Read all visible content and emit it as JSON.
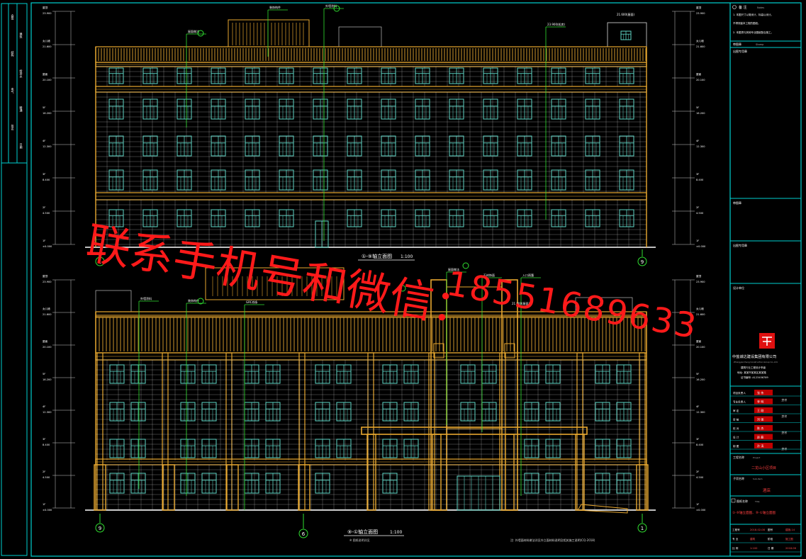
{
  "drawing": {
    "upper_title": "①-⑨轴立面图",
    "upper_scale": "1:100",
    "lower_title": "⑨-①轴立面图",
    "lower_scale": "1:100",
    "lower_subnote": "※ 图纸说明详见",
    "upper_axis_left": "1",
    "upper_axis_right": "9",
    "lower_axis_left": "9",
    "lower_axis_mid": "6",
    "lower_axis_right": "1",
    "bottom_note": "注: 外墙面材料做法详见外立面材料说明及相关施工说明(CQ-2018)"
  },
  "elevation_labels_left": [
    {
      "level": "1F",
      "value": "±0.000"
    },
    {
      "level": "2F",
      "value": "4.500"
    },
    {
      "level": "3F",
      "value": "8.400"
    },
    {
      "level": "4F",
      "value": "12.300"
    },
    {
      "level": "5F",
      "value": "16.200"
    },
    {
      "level": "屋面",
      "value": "20.100"
    },
    {
      "level": "女儿墙",
      "value": "21.600"
    },
    {
      "level": "屋顶",
      "value": "23.900"
    }
  ],
  "upper_callouts": [
    "屋面做法",
    "装饰构件",
    "外墙涂料",
    "21.600(屋面)",
    "23.900(机房)"
  ],
  "lower_callouts": [
    "外墙涂料",
    "装饰构件",
    "屋面做法",
    "GRC线条",
    "21.600(屋面)",
    "入口雨篷",
    "石材饰面"
  ],
  "title_block": {
    "notes_heading": "备 注",
    "notes_heading_en": "Notes",
    "notes": [
      "1. 本图尺寸以毫米计，标高以米计。",
      "不得测量本工程的图纸。",
      "2. 本图须与其他专业图纸配合施工。"
    ],
    "drawing_stamp": "审图章",
    "stamp_en": "Stamp",
    "chop_label": "出图专用章",
    "design_heading": "设计单位",
    "company_name": "中盐诚达建设集团有限公司",
    "company_en": "Zhongyancheng Construction Group Co.,Ltd.",
    "company_sub": "建筑行业工程设计甲级",
    "company_address": "地址: 某某市某某区某某路",
    "company_cert": "证书编号: A123456789",
    "roles": [
      {
        "role": "项目负责人",
        "name": "张 伟"
      },
      {
        "role": "专业负责人",
        "name": "李 明"
      },
      {
        "role": "审 定",
        "name": "王 刚"
      },
      {
        "role": "审 核",
        "name": "刘 强"
      },
      {
        "role": "校 对",
        "name": "陈 杰"
      },
      {
        "role": "设 计",
        "name": "赵 磊"
      },
      {
        "role": "制 图",
        "name": "孙 涛"
      }
    ],
    "signatures": [
      "签名",
      "签名",
      "签名",
      "签名"
    ],
    "project_label": "工程名称",
    "project_label_en": "Project",
    "project_name": "二龙山小区项目",
    "subproject_label": "子项名称",
    "subproject_label_en": "Sub-item",
    "subproject_name": "酒店",
    "drawing_name_label": "图纸名称",
    "drawing_name_label_en": "Title",
    "drawing_name": "①-⑨轴立面图、⑨-①轴立面图",
    "info_row1": [
      "工程号",
      "2018-02-08",
      "图号",
      "建施-14"
    ],
    "info_row2": [
      "专 业",
      "建筑",
      "阶段",
      "施工图"
    ],
    "info_row3": [
      "比 例",
      "1:100",
      "日 期",
      "2018.06"
    ]
  },
  "left_strip": {
    "labels": [
      "会签",
      "建筑",
      "结构",
      "给排水",
      "电气",
      "暖通",
      "签名",
      "日期"
    ]
  },
  "watermark": {
    "line1": "联系手机号和微信：",
    "line2": "18551689633"
  },
  "colors": {
    "background": "#000000",
    "frame": "#00d0d0",
    "facade": "#e8a830",
    "window": "#5fd6c6",
    "grid_white": "#d8d8d8",
    "leader": "#30e030",
    "watermark": "#ff1a1a",
    "logo": "#e01010"
  }
}
